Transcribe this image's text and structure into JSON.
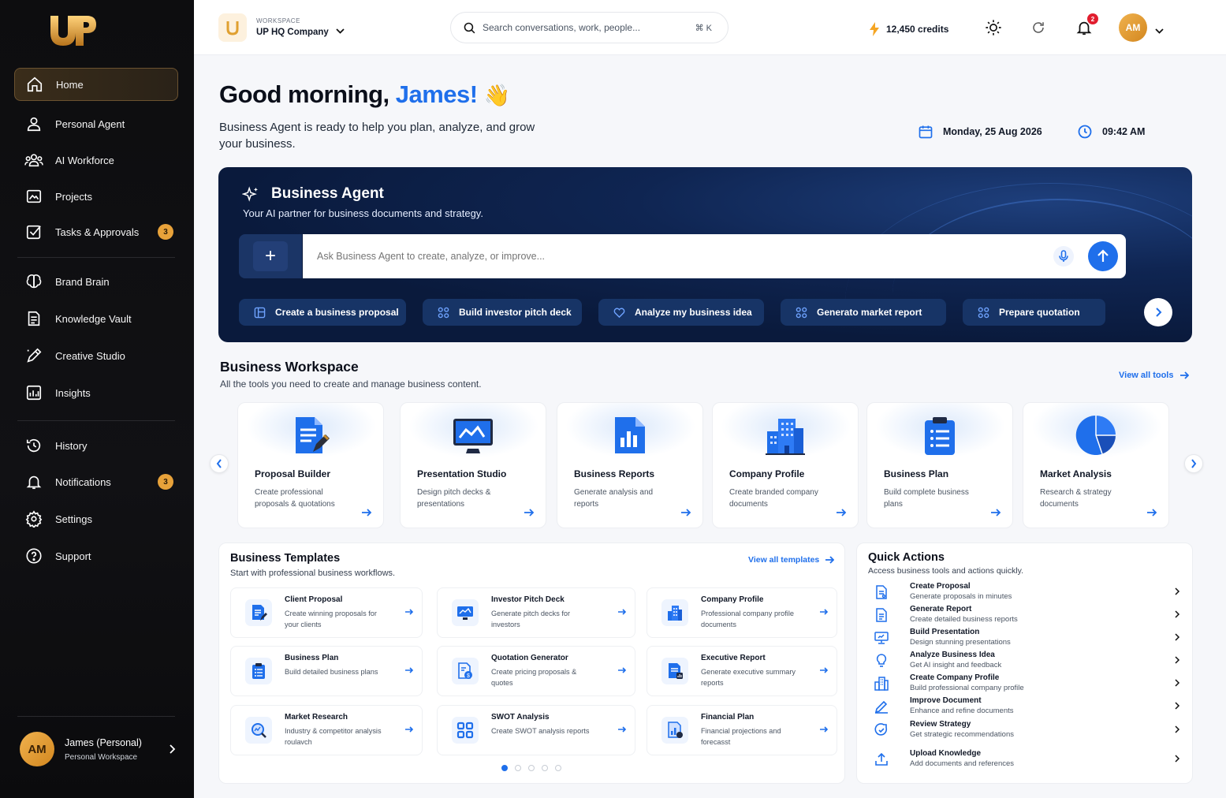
{
  "brand": {
    "logo_text": "UP"
  },
  "sidebar": {
    "items": [
      {
        "label": "Home",
        "icon": "home-icon"
      },
      {
        "label": "Personal Agent",
        "icon": "user-icon"
      },
      {
        "label": "AI Workforce",
        "icon": "team-icon"
      },
      {
        "label": "Projects",
        "icon": "projects-icon"
      },
      {
        "label": "Tasks & Approvals",
        "icon": "checkbox-icon",
        "badge": "3"
      },
      {
        "label": "Brand Brain",
        "icon": "brain-icon"
      },
      {
        "label": "Knowledge Vault",
        "icon": "document-icon"
      },
      {
        "label": "Creative Studio",
        "icon": "pen-icon"
      },
      {
        "label": "Insights",
        "icon": "chart-icon"
      },
      {
        "label": "History",
        "icon": "history-icon"
      },
      {
        "label": "Notifications",
        "icon": "bell-icon",
        "badge": "3"
      },
      {
        "label": "Settings",
        "icon": "gear-icon"
      },
      {
        "label": "Support",
        "icon": "help-icon"
      }
    ],
    "user": {
      "initials": "AM",
      "name": "James (Personal)",
      "workspace": "Personal Workspace"
    }
  },
  "topbar": {
    "workspace_label": "WORKSPACE",
    "workspace_name": "UP HQ Company",
    "search_placeholder": "Search conversations, work, people...",
    "search_shortcut": "⌘ K",
    "credits": "12,450 credits",
    "notification_count": "2",
    "avatar_initials": "AM"
  },
  "hero": {
    "greeting": "Good morning, ",
    "name": "James!",
    "emoji": "👋",
    "subtitle": "Business Agent is ready to help you plan, analyze, and grow your business.",
    "date": "Monday, 25 Aug 2026",
    "time": "09:42 AM"
  },
  "agent": {
    "title": "Business Agent",
    "subtitle": "Your AI partner for business documents and strategy.",
    "input_placeholder": "Ask Business Agent to create, analyze, or improve...",
    "chips": [
      "Create a business proposal",
      "Build investor pitch deck",
      "Analyze my business idea",
      "Generato market report",
      "Prepare quotation"
    ]
  },
  "workspace": {
    "title": "Business Workspace",
    "subtitle": "All the tools you need to create and manage business content.",
    "view_all": "View all tools",
    "tools": [
      {
        "title": "Proposal Builder",
        "desc": "Create professional proposals & quotations"
      },
      {
        "title": "Presentation Studio",
        "desc": "Design pitch decks & presentations"
      },
      {
        "title": "Business Reports",
        "desc": "Generate analysis and reports"
      },
      {
        "title": "Company Profile",
        "desc": "Create branded company documents"
      },
      {
        "title": "Business Plan",
        "desc": "Build complete business plans"
      },
      {
        "title": "Market Analysis",
        "desc": "Research & strategy documents"
      }
    ]
  },
  "templates": {
    "title": "Business Templates",
    "subtitle": "Start with professional business workflows.",
    "view_all": "View all templates",
    "items": [
      {
        "title": "Client Proposal",
        "desc": "Create winning proposals for your clients"
      },
      {
        "title": "Investor Pitch Deck",
        "desc": "Generate pitch decks for investors"
      },
      {
        "title": "Company Profile",
        "desc": "Professional company profile documents"
      },
      {
        "title": "Business Plan",
        "desc": "Build detailed business plans"
      },
      {
        "title": "Quotation Generator",
        "desc": "Create pricing proposals & quotes"
      },
      {
        "title": "Executive Report",
        "desc": "Generate executive summary reports"
      },
      {
        "title": "Market Research",
        "desc": "Industry & competitor analysis roulavch"
      },
      {
        "title": "SWOT Analysis",
        "desc": "Create SWOT analysis reports"
      },
      {
        "title": "Financial Plan",
        "desc": "Financial projections and forecasst"
      }
    ]
  },
  "quick_actions": {
    "title": "Quick Actions",
    "subtitle": "Access business tools and actions quickly.",
    "items": [
      {
        "title": "Create Proposal",
        "desc": "Generate proposals in minutes"
      },
      {
        "title": "Generate Report",
        "desc": "Create detailed business reports"
      },
      {
        "title": "Build Presentation",
        "desc": "Design stunning presentations"
      },
      {
        "title": "Analyze Business Idea",
        "desc": "Get AI insight and feedback"
      },
      {
        "title": "Create Company Profile",
        "desc": "Build professional company profile"
      },
      {
        "title": "Improve Document",
        "desc": "Enhance and refine documents"
      },
      {
        "title": "Review Strategy",
        "desc": "Get strategic recommendations"
      },
      {
        "title": "Upload Knowledge",
        "desc": "Add documents and references"
      }
    ]
  },
  "colors": {
    "accent": "#1f6feb",
    "gold": "#e8a23a",
    "sidebar_bg": "#0d0d0f",
    "agent_bg": "#0f2552"
  }
}
